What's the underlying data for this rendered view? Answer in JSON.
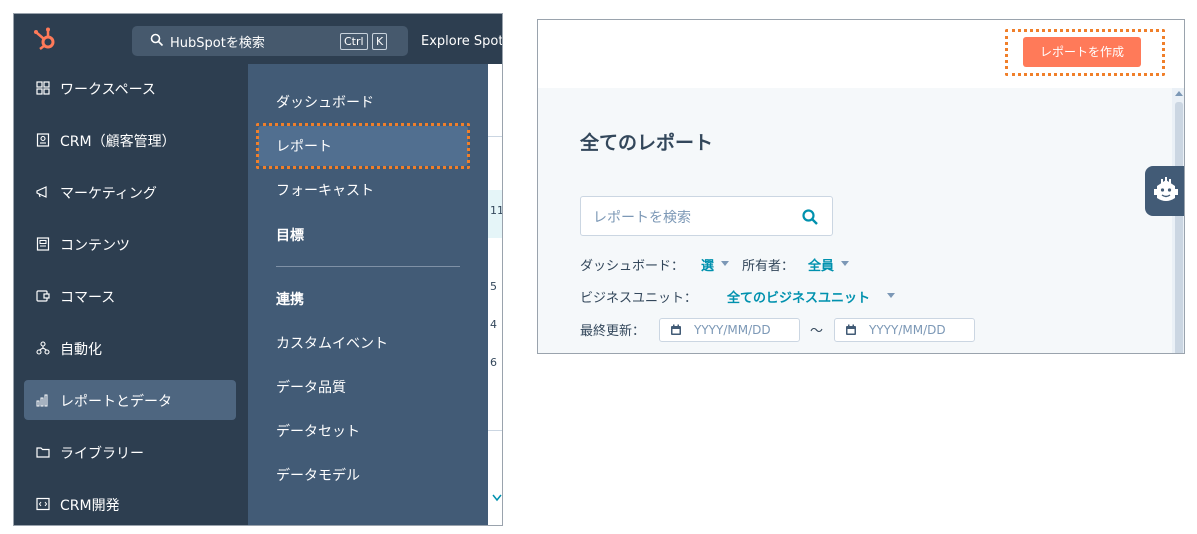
{
  "left": {
    "topbar": {
      "search_placeholder": "HubSpotを検索",
      "shortcut_ctrl": "Ctrl",
      "shortcut_k": "K",
      "explore": "Explore Spotl"
    },
    "sidebar": {
      "items": [
        {
          "label": "ワークスペース",
          "icon": "grid-icon"
        },
        {
          "label": "CRM（顧客管理）",
          "icon": "contact-card-icon"
        },
        {
          "label": "マーケティング",
          "icon": "megaphone-icon"
        },
        {
          "label": "コンテンツ",
          "icon": "content-icon"
        },
        {
          "label": "コマース",
          "icon": "commerce-icon"
        },
        {
          "label": "自動化",
          "icon": "workflow-icon"
        },
        {
          "label": "レポートとデータ",
          "icon": "bar-chart-icon"
        },
        {
          "label": "ライブラリー",
          "icon": "folder-icon"
        },
        {
          "label": "CRM開発",
          "icon": "code-icon"
        }
      ],
      "active_index": 6
    },
    "submenu": {
      "items": [
        "ダッシュボード",
        "レポート",
        "フォーキャスト",
        "目標",
        "連携",
        "カスタムイベント",
        "データ品質",
        "データセット",
        "データモデル"
      ],
      "active_index": 1
    },
    "peek_numbers": [
      "11",
      "5",
      "4",
      "6"
    ]
  },
  "right": {
    "create_button": "レポートを作成",
    "page_title": "全てのレポート",
    "search_placeholder": "レポートを検索",
    "filters": {
      "dashboard_label": "ダッシュボード：",
      "dashboard_value": "選",
      "owner_label": "所有者：",
      "owner_value": "全員",
      "business_unit_label": "ビジネスユニット：",
      "business_unit_value": "全てのビジネスユニット",
      "last_updated_label": "最終更新：",
      "date_placeholder_from": "YYYY/MM/DD",
      "date_separator": "～",
      "date_placeholder_to": "YYYY/MM/DD"
    }
  },
  "colors": {
    "nav_bg": "#2d3e50",
    "submenu_bg": "#425b76",
    "highlight": "#f07f2a",
    "cta": "#ff7a59",
    "link": "#0091ae"
  }
}
